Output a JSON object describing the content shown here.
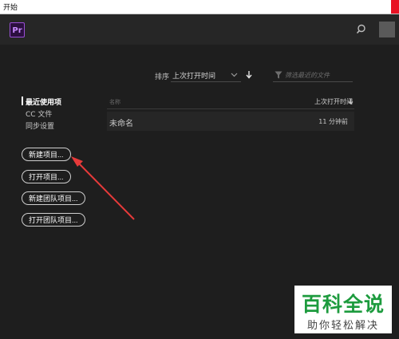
{
  "window": {
    "title": "开始"
  },
  "header": {
    "logo_text": "Pr",
    "search_icon": "search-icon",
    "avatar_icon": "user-avatar"
  },
  "toolbar": {
    "sort_label": "排序",
    "sort_value": "上次打开时间",
    "filter_placeholder": "筛选最近的文件"
  },
  "sidebar": {
    "items": [
      {
        "label": "最近使用项",
        "active": true
      },
      {
        "label": "CC 文件",
        "active": false
      },
      {
        "label": "同步设置",
        "active": false
      }
    ]
  },
  "actions": {
    "new_project": "新建项目...",
    "open_project": "打开项目...",
    "new_team_project": "新建团队项目...",
    "open_team_project": "打开团队项目..."
  },
  "table": {
    "columns": {
      "name": "名称",
      "last_opened": "上次打开时间"
    },
    "rows": [
      {
        "name": "未命名",
        "time": "11 分钟前"
      }
    ]
  },
  "annotation": {
    "color": "#e63a3a"
  },
  "watermark": {
    "main": "百科全说",
    "sub": "助你轻松解决"
  },
  "colors": {
    "brand": "#9a4fd6",
    "background": "#1e1e1e",
    "watermark_green": "#1d9b3e"
  }
}
